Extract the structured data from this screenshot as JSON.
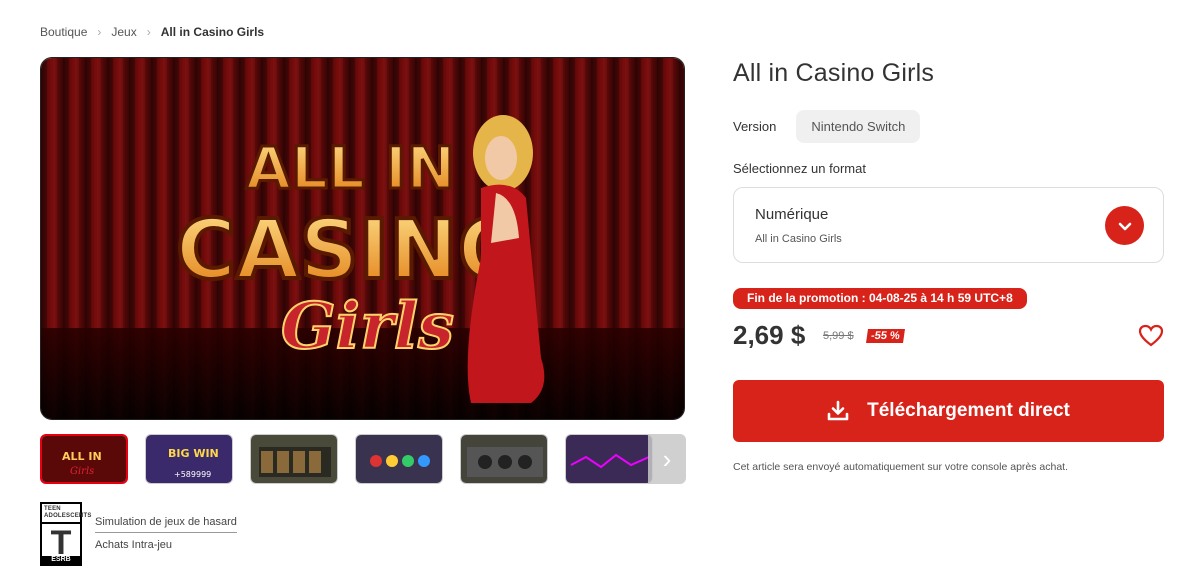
{
  "breadcrumb": {
    "items": [
      "Boutique",
      "Jeux"
    ],
    "current": "All in Casino Girls"
  },
  "hero": {
    "line1": "ALL IN",
    "line2": "CASINO",
    "line3": "Girls"
  },
  "thumbnails": [
    {
      "caption": "ALL IN",
      "sub": "Girls"
    },
    {
      "caption": "BIG WIN",
      "sub": "+589999"
    },
    {
      "caption": "",
      "sub": ""
    },
    {
      "caption": "",
      "sub": ""
    },
    {
      "caption": "",
      "sub": ""
    },
    {
      "caption": "",
      "sub": ""
    }
  ],
  "rating": {
    "board_label": "TEEN ADOLESCENTS",
    "letter": "T",
    "board": "ESRB",
    "descriptors": [
      "Simulation de jeux de hasard",
      "Achats Intra-jeu"
    ]
  },
  "product": {
    "title": "All in Casino Girls",
    "version_label": "Version",
    "version_value": "Nintendo Switch",
    "format_label": "Sélectionnez un format",
    "format_name": "Numérique",
    "format_sub": "All in Casino Girls",
    "promo": "Fin de la promotion : 04-08-25 à 14 h 59 UTC+8",
    "price": "2,69 $",
    "old_price": "5,99 $",
    "discount": "-55 %",
    "download_label": "Téléchargement direct",
    "note": "Cet article sera envoyé automatiquement sur votre console après achat."
  },
  "colors": {
    "accent": "#d8231b"
  },
  "icons": [
    "chevron-right-icon",
    "chevron-down-icon",
    "heart-icon",
    "download-icon"
  ]
}
